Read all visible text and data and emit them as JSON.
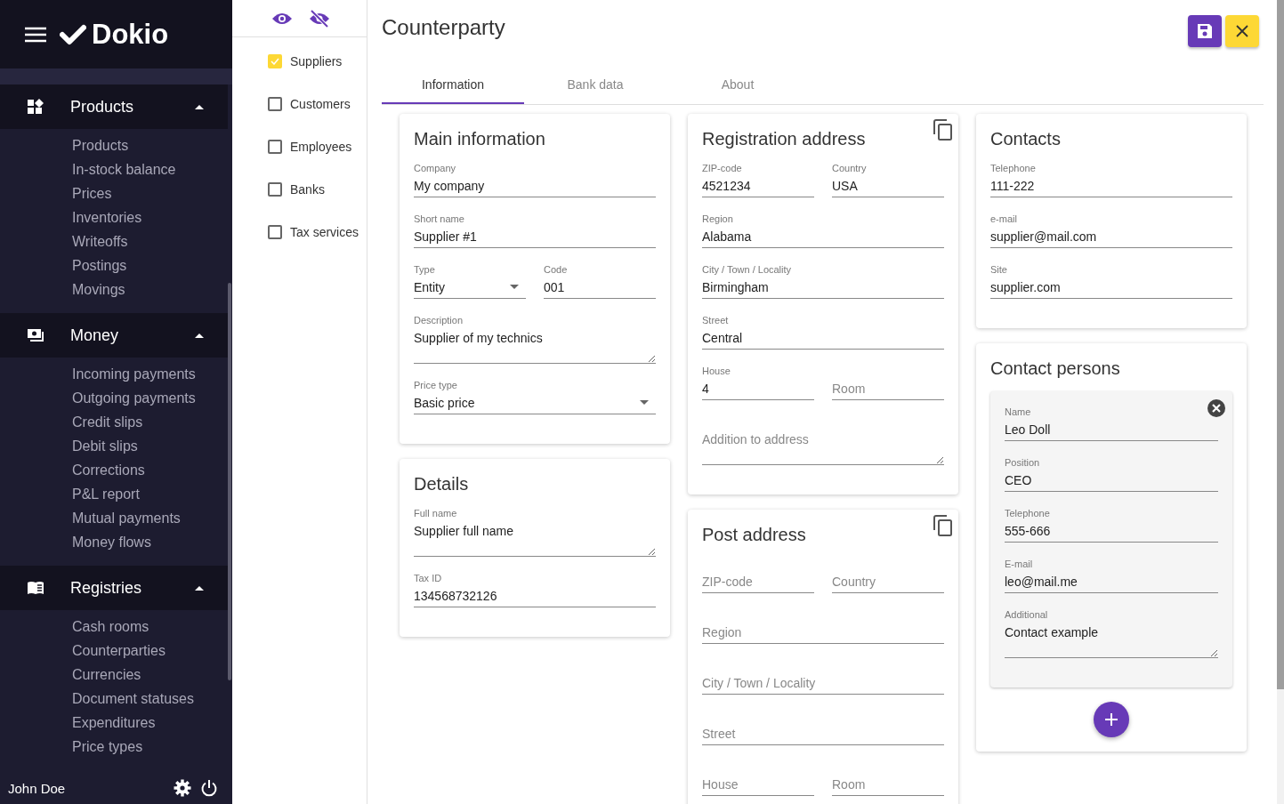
{
  "sidebar": {
    "logo": "Dokio",
    "groups": [
      {
        "title": "Products",
        "expanded": true,
        "items": [
          "Products",
          "In-stock balance",
          "Prices",
          "Inventories",
          "Writeoffs",
          "Postings",
          "Movings"
        ]
      },
      {
        "title": "Money",
        "expanded": true,
        "items": [
          "Incoming payments",
          "Outgoing payments",
          "Credit slips",
          "Debit slips",
          "Corrections",
          "P&L report",
          "Mutual payments",
          "Money flows"
        ]
      },
      {
        "title": "Registries",
        "expanded": true,
        "items": [
          "Cash rooms",
          "Counterparties",
          "Currencies",
          "Document statuses",
          "Expenditures",
          "Price types"
        ]
      }
    ],
    "user": "John Doe"
  },
  "filters": [
    {
      "label": "Suppliers",
      "checked": true
    },
    {
      "label": "Customers",
      "checked": false
    },
    {
      "label": "Employees",
      "checked": false
    },
    {
      "label": "Banks",
      "checked": false
    },
    {
      "label": "Tax services",
      "checked": false
    }
  ],
  "page": {
    "title": "Counterparty"
  },
  "tabs": [
    {
      "label": "Information",
      "selected": true
    },
    {
      "label": "Bank data",
      "selected": false
    },
    {
      "label": "About",
      "selected": false
    }
  ],
  "columns": [
    {
      "cards": [
        {
          "title": "Main information",
          "copy_button": false,
          "rows": [
            [
              {
                "kind": "text",
                "label": "Company",
                "value": "My company"
              }
            ],
            [
              {
                "kind": "text",
                "label": "Short name",
                "value": "Supplier #1"
              }
            ],
            [
              {
                "kind": "select",
                "label": "Type",
                "value": "Entity"
              },
              {
                "kind": "text",
                "label": "Code",
                "value": "001"
              }
            ],
            [
              {
                "kind": "textarea",
                "label": "Description",
                "value": "Supplier of my technics"
              }
            ],
            [
              {
                "kind": "select",
                "label": "Price type",
                "value": "Basic price"
              }
            ]
          ]
        },
        {
          "title": "Details",
          "copy_button": false,
          "rows": [
            [
              {
                "kind": "textarea",
                "label": "Full name",
                "value": "Supplier full name"
              }
            ],
            [
              {
                "kind": "text",
                "label": "Tax ID",
                "value": "134568732126"
              }
            ]
          ]
        }
      ]
    },
    {
      "cards": [
        {
          "title": "Registration address",
          "copy_button": true,
          "rows": [
            [
              {
                "kind": "text",
                "label": "ZIP-code",
                "value": "4521234"
              },
              {
                "kind": "text",
                "label": "Country",
                "value": "USA"
              }
            ],
            [
              {
                "kind": "text",
                "label": "Region",
                "value": "Alabama"
              }
            ],
            [
              {
                "kind": "text",
                "label": "City / Town / Locality",
                "value": "Birmingham"
              }
            ],
            [
              {
                "kind": "text",
                "label": "Street",
                "value": "Central"
              }
            ],
            [
              {
                "kind": "text",
                "label": "House",
                "value": "4"
              },
              {
                "kind": "text",
                "placeholder": "Room"
              }
            ],
            [
              {
                "kind": "textarea",
                "placeholder": "Addition to address"
              }
            ]
          ]
        },
        {
          "title": "Post address",
          "copy_button": true,
          "rows": [
            [
              {
                "kind": "text",
                "placeholder": "ZIP-code"
              },
              {
                "kind": "text",
                "placeholder": "Country"
              }
            ],
            [
              {
                "kind": "text",
                "placeholder": "Region"
              }
            ],
            [
              {
                "kind": "text",
                "placeholder": "City / Town / Locality"
              }
            ],
            [
              {
                "kind": "text",
                "placeholder": "Street"
              }
            ],
            [
              {
                "kind": "text",
                "placeholder": "House"
              },
              {
                "kind": "text",
                "placeholder": "Room"
              }
            ]
          ]
        }
      ]
    },
    {
      "cards": [
        {
          "title": "Contacts",
          "copy_button": false,
          "rows": [
            [
              {
                "kind": "text",
                "label": "Telephone",
                "value": "111-222"
              }
            ],
            [
              {
                "kind": "text",
                "label": "e-mail",
                "value": "supplier@mail.com"
              }
            ],
            [
              {
                "kind": "text",
                "label": "Site",
                "value": "supplier.com"
              }
            ]
          ]
        },
        {
          "title": "Contact persons",
          "copy_button": false,
          "persons": [
            {
              "rows": [
                [
                  {
                    "kind": "text",
                    "label": "Name",
                    "value": "Leo Doll"
                  }
                ],
                [
                  {
                    "kind": "text",
                    "label": "Position",
                    "value": "CEO"
                  }
                ],
                [
                  {
                    "kind": "text",
                    "label": "Telephone",
                    "value": "555-666"
                  }
                ],
                [
                  {
                    "kind": "text",
                    "label": "E-mail",
                    "value": "leo@mail.me"
                  }
                ],
                [
                  {
                    "kind": "textarea",
                    "label": "Additional",
                    "value": "Contact example"
                  }
                ]
              ]
            }
          ]
        }
      ]
    }
  ]
}
